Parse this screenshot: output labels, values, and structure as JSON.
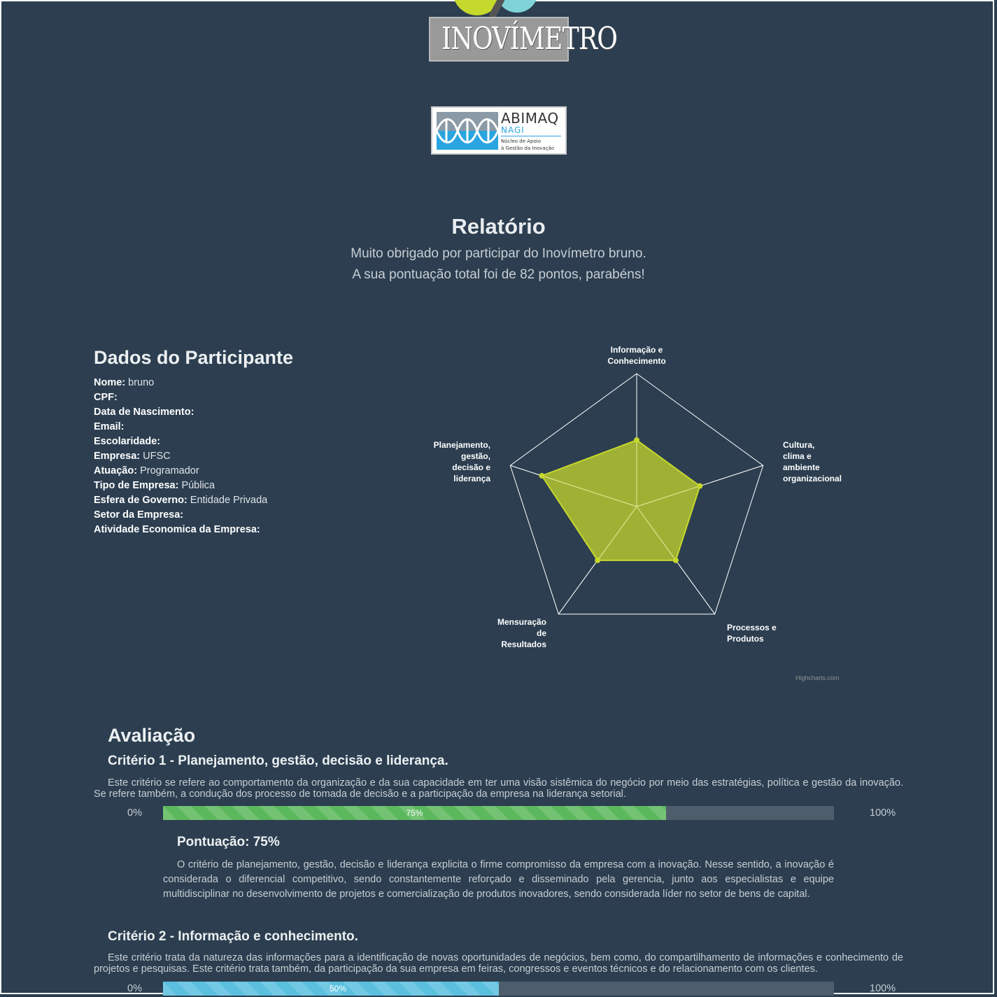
{
  "logos": {
    "inovimetro_text": "INOVÍMETRO",
    "abimaq_name": "ABIMAQ",
    "abimaq_unit": "NAGI",
    "abimaq_line1": "Núcleo de Apoio",
    "abimaq_line2": "à Gestão da Inovação"
  },
  "header": {
    "title": "Relatório",
    "thanks": "Muito obrigado por participar do Inovímetro bruno.",
    "score_message": "A sua pontuação total foi de 82 pontos, parabéns!"
  },
  "participant": {
    "heading": "Dados do Participante",
    "fields": [
      {
        "label": "Nome:",
        "value": "bruno"
      },
      {
        "label": "CPF:",
        "value": ""
      },
      {
        "label": "Data de Nascimento:",
        "value": ""
      },
      {
        "label": "Email:",
        "value": ""
      },
      {
        "label": "Escolaridade:",
        "value": ""
      },
      {
        "label": "Empresa:",
        "value": "UFSC"
      },
      {
        "label": "Atuação:",
        "value": "Programador"
      },
      {
        "label": "Tipo de Empresa:",
        "value": "Pública"
      },
      {
        "label": "Esfera de Governo:",
        "value": "Entidade Privada"
      },
      {
        "label": "Setor da Empresa:",
        "value": ""
      },
      {
        "label": "Atividade Economica da Empresa:",
        "value": ""
      }
    ]
  },
  "chart_data": {
    "type": "radar",
    "categories": [
      "Informação e Conhecimento",
      "Cultura, clima e ambiente organizacional",
      "Processos e Produtos",
      "Mensuração de Resultados",
      "Planejamento, gestão, decisão e liderança"
    ],
    "values": [
      50,
      50,
      50,
      50,
      75
    ],
    "ylim": [
      0,
      100
    ],
    "series_color": "#c5d82c",
    "grid": true,
    "credit": "Highcharts.com"
  },
  "evaluation": {
    "heading": "Avaliação",
    "min_label": "0%",
    "max_label": "100%",
    "criteria": [
      {
        "title": "Critério 1 - Planejamento, gestão, decisão e liderança.",
        "description": "Este critério se refere ao comportamento da organização e da sua capacidade em ter uma visão sistêmica do negócio por meio das estratégias, política e gestão da inovação. Se refere também, a condução dos processo de tomada de decisão e a participação da empresa na liderança setorial.",
        "percent": 75,
        "percent_label": "75%",
        "color": "#5cb85c",
        "score_title": "Pontuação: 75%",
        "score_text": "O critério de planejamento, gestão, decisão e liderança explicita o firme compromisso da empresa com a inovação. Nesse sentido, a inovação é considerada o diferencial competitivo, sendo constantemente reforçado e disseminado pela gerencia, junto aos especialistas e equipe multidisciplinar no desenvolvimento de projetos e comercialização de produtos inovadores, sendo considerada líder no setor de bens de capital."
      },
      {
        "title": "Critério 2 - Informação e conhecimento.",
        "description": "Este critério trata da natureza das informações para a identificação de novas oportunidades de negócios, bem como, do compartilhamento de informações e conhecimento de projetos e pesquisas. Este critério trata também, da participação da sua empresa em feiras, congressos e eventos técnicos e do relacionamento com os clientes.",
        "percent": 50,
        "percent_label": "50%",
        "color": "#5bc0de"
      }
    ]
  }
}
